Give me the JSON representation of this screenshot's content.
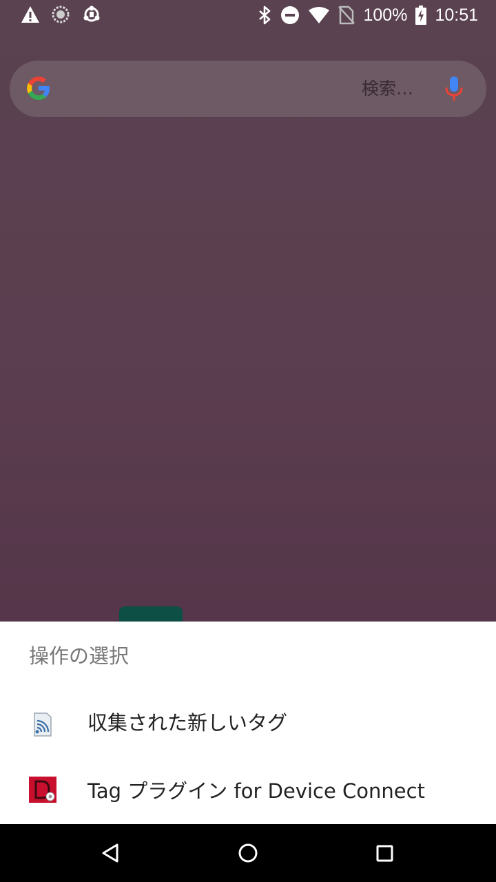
{
  "status_bar": {
    "battery_percent": "100%",
    "time": "10:51",
    "left_icons": [
      "warning-icon",
      "sync-icon",
      "usb-debug-icon"
    ],
    "right_icons": [
      "bluetooth-icon",
      "do-not-disturb-icon",
      "wifi-icon",
      "no-sim-icon",
      "battery-charging-icon"
    ]
  },
  "search_widget": {
    "placeholder": "検索…",
    "icons": [
      "google-logo-icon",
      "mic-icon"
    ]
  },
  "chooser_sheet": {
    "title": "操作の選択",
    "items": [
      {
        "label": "収集された新しいタグ",
        "icon": "nfc-tag-app-icon"
      },
      {
        "label": "Tag プラグイン for Device Connect",
        "icon": "device-connect-app-icon"
      }
    ]
  },
  "nav_bar": {
    "buttons": [
      "back-icon",
      "home-icon",
      "recents-icon"
    ]
  },
  "colors": {
    "wallpaper": "#5a4250",
    "sheet_background": "#ffffff",
    "title_text": "#777777",
    "item_text": "#222222",
    "nav_background": "#000000"
  }
}
